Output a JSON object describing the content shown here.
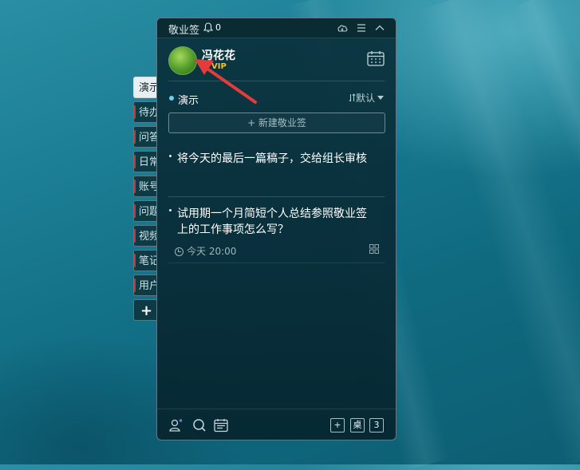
{
  "side_tabs": [
    {
      "label": "演示",
      "active": true
    },
    {
      "label": "待办"
    },
    {
      "label": "问答"
    },
    {
      "label": "日常"
    },
    {
      "label": "账号"
    },
    {
      "label": "问题"
    },
    {
      "label": "视频"
    },
    {
      "label": "笔记"
    },
    {
      "label": "用户"
    }
  ],
  "add_tab_label": "+",
  "panel": {
    "title": "敬业签",
    "notification_count": "0",
    "titlebar_icons": [
      "cloud-icon",
      "menu-icon",
      "collapse-icon"
    ]
  },
  "user": {
    "name": "冯花花",
    "badge": "VIP",
    "badge_color": "#f2c42b"
  },
  "category": {
    "name": "演示",
    "dot_color": "#6fd1e6",
    "sort_label": "默认",
    "sort_icon": "sort-icon"
  },
  "new_note_button": "+ 新建敬业签",
  "notes": [
    {
      "text": "将今天的最后一篇稿子，交给组长审核"
    },
    {
      "text": "试用期一个月简短个人总结参照敬业签上的工作事项怎么写？",
      "time": "今天 20:00"
    }
  ],
  "bottom_bar": {
    "left_icons": [
      "contacts-icon",
      "search-icon",
      "calendar-icon"
    ],
    "buttons": [
      "+",
      "桌",
      "3"
    ]
  },
  "colors": {
    "panel_bg": "#0a3440",
    "accent": "#6fd1e6",
    "active_tab_bg": "#e9eef0",
    "tab_marker": "#c13a3a"
  }
}
